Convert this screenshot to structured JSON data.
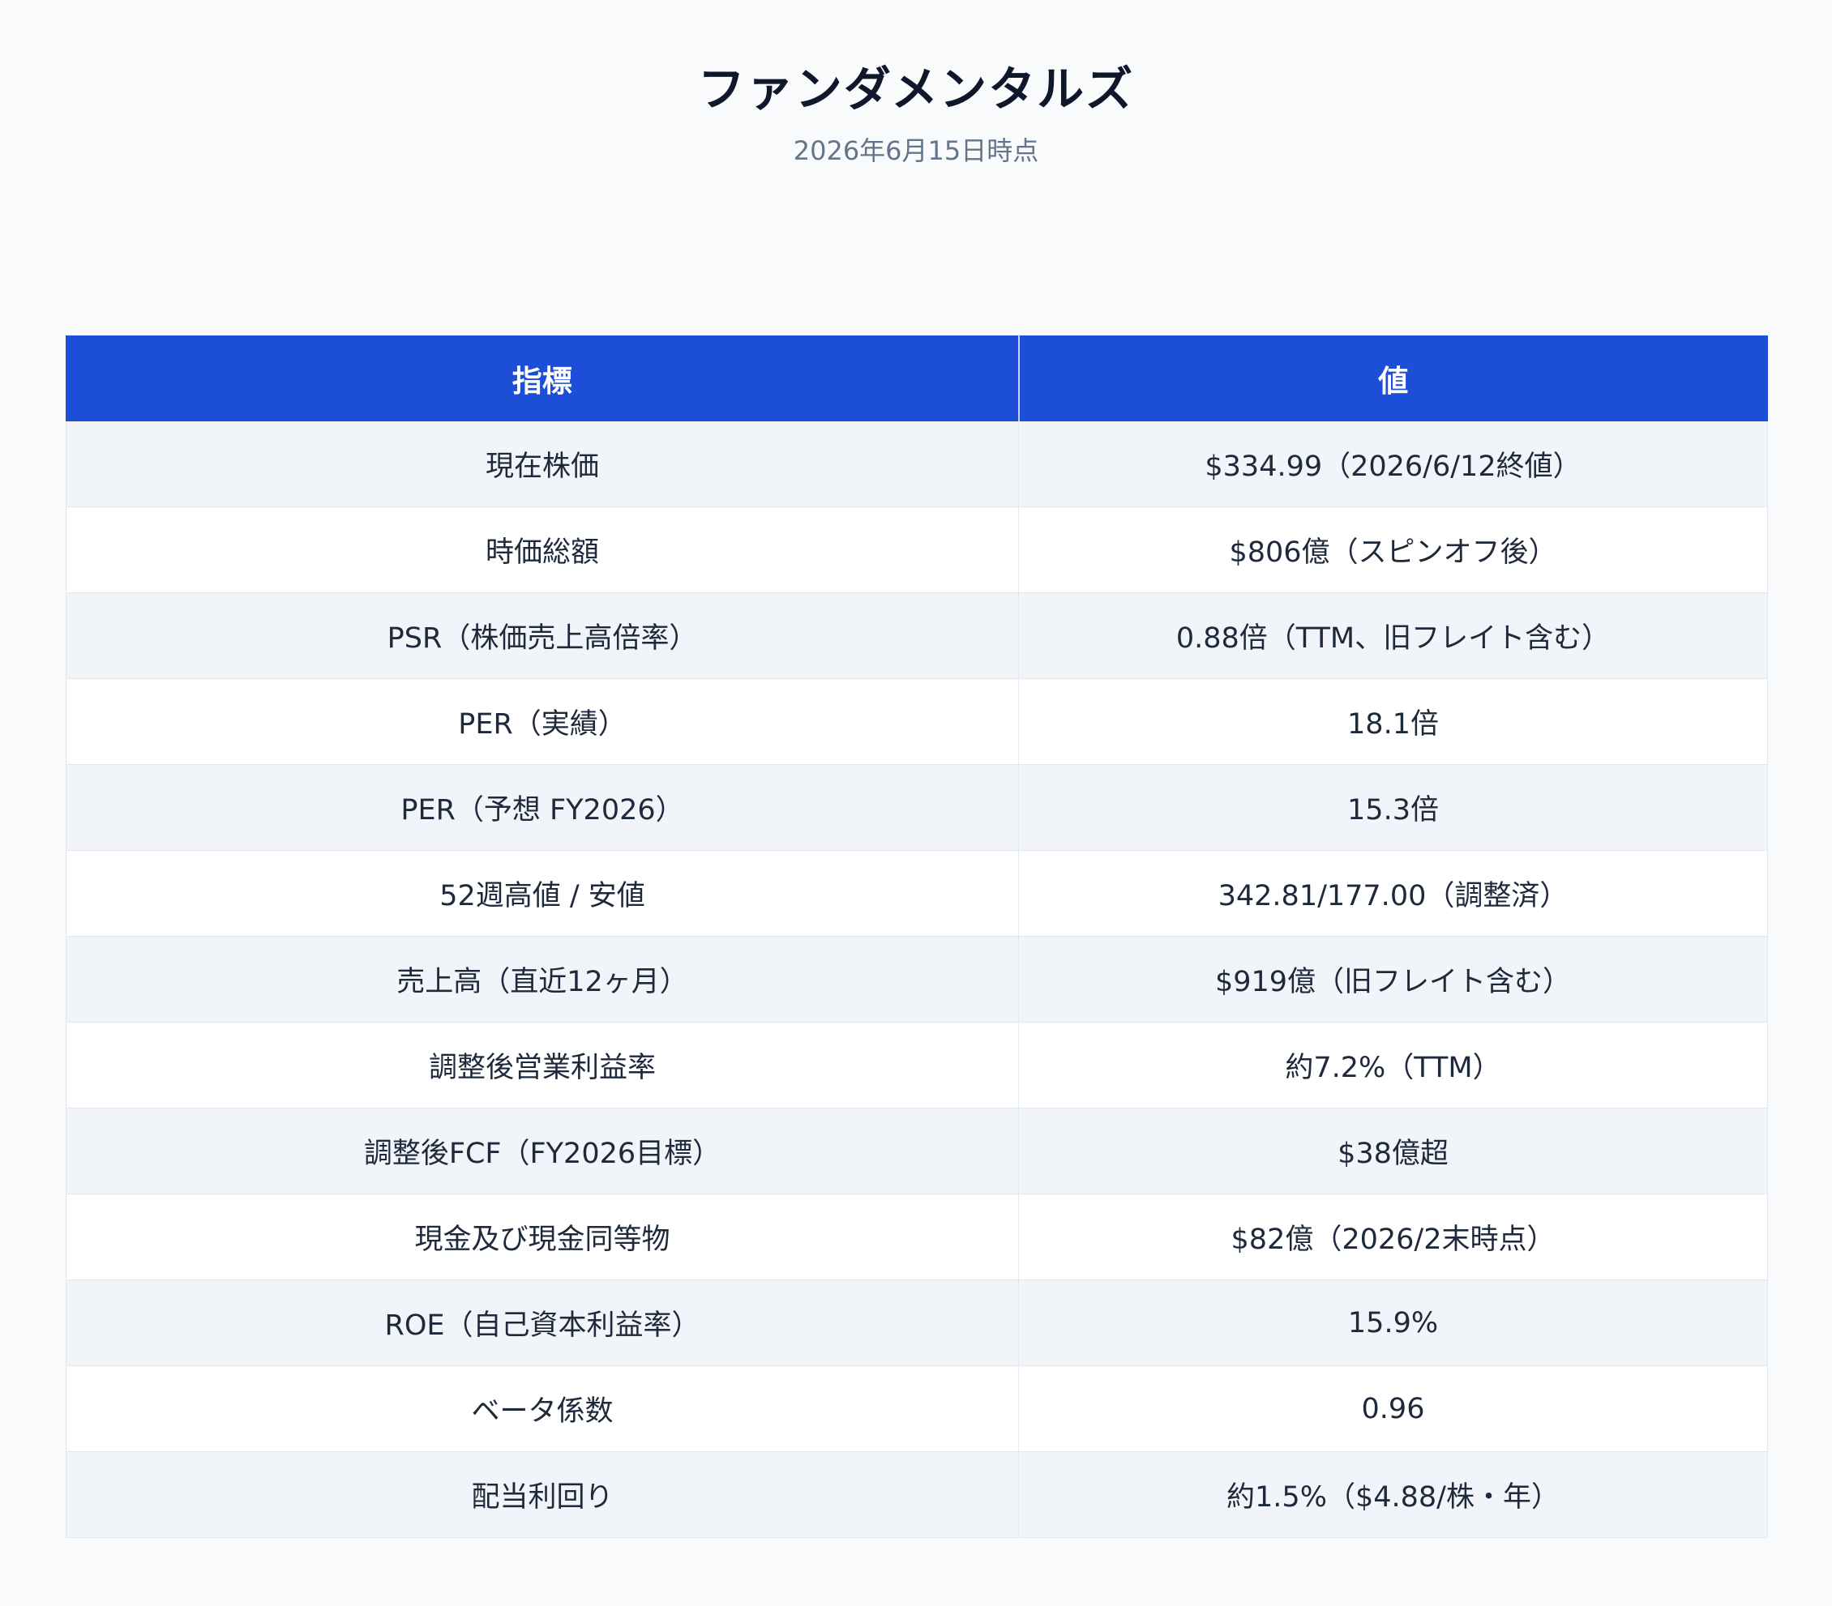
{
  "header": {
    "title": "ファンダメンタルズ",
    "subtitle": "2026年6月15日時点"
  },
  "table": {
    "columns": [
      "指標",
      "値"
    ],
    "rows": [
      {
        "metric": "現在株価",
        "value": "$334.99（2026/6/12終値）"
      },
      {
        "metric": "時価総額",
        "value": "$806億（スピンオフ後）"
      },
      {
        "metric": "PSR（株価売上高倍率）",
        "value": "0.88倍（TTM、旧フレイト含む）"
      },
      {
        "metric": "PER（実績）",
        "value": "18.1倍"
      },
      {
        "metric": "PER（予想 FY2026）",
        "value": "15.3倍"
      },
      {
        "metric": "52週高値 / 安値",
        "value": "342.81/177.00（調整済）"
      },
      {
        "metric": "売上高（直近12ヶ月）",
        "value": "$919億（旧フレイト含む）"
      },
      {
        "metric": "調整後営業利益率",
        "value": "約7.2%（TTM）"
      },
      {
        "metric": "調整後FCF（FY2026目標）",
        "value": "$38億超"
      },
      {
        "metric": "現金及び現金同等物",
        "value": "$82億（2026/2末時点）"
      },
      {
        "metric": "ROE（自己資本利益率）",
        "value": "15.9%"
      },
      {
        "metric": "ベータ係数",
        "value": "0.96"
      },
      {
        "metric": "配当利回り",
        "value": "約1.5%（$4.88/株・年）"
      }
    ]
  },
  "colors": {
    "header_bg": "#1d4ed8",
    "header_text": "#ffffff",
    "row_alt_bg": "#f1f5f9",
    "row_bg": "#ffffff",
    "page_bg": "#f8fafc",
    "subtitle": "#64748b"
  }
}
